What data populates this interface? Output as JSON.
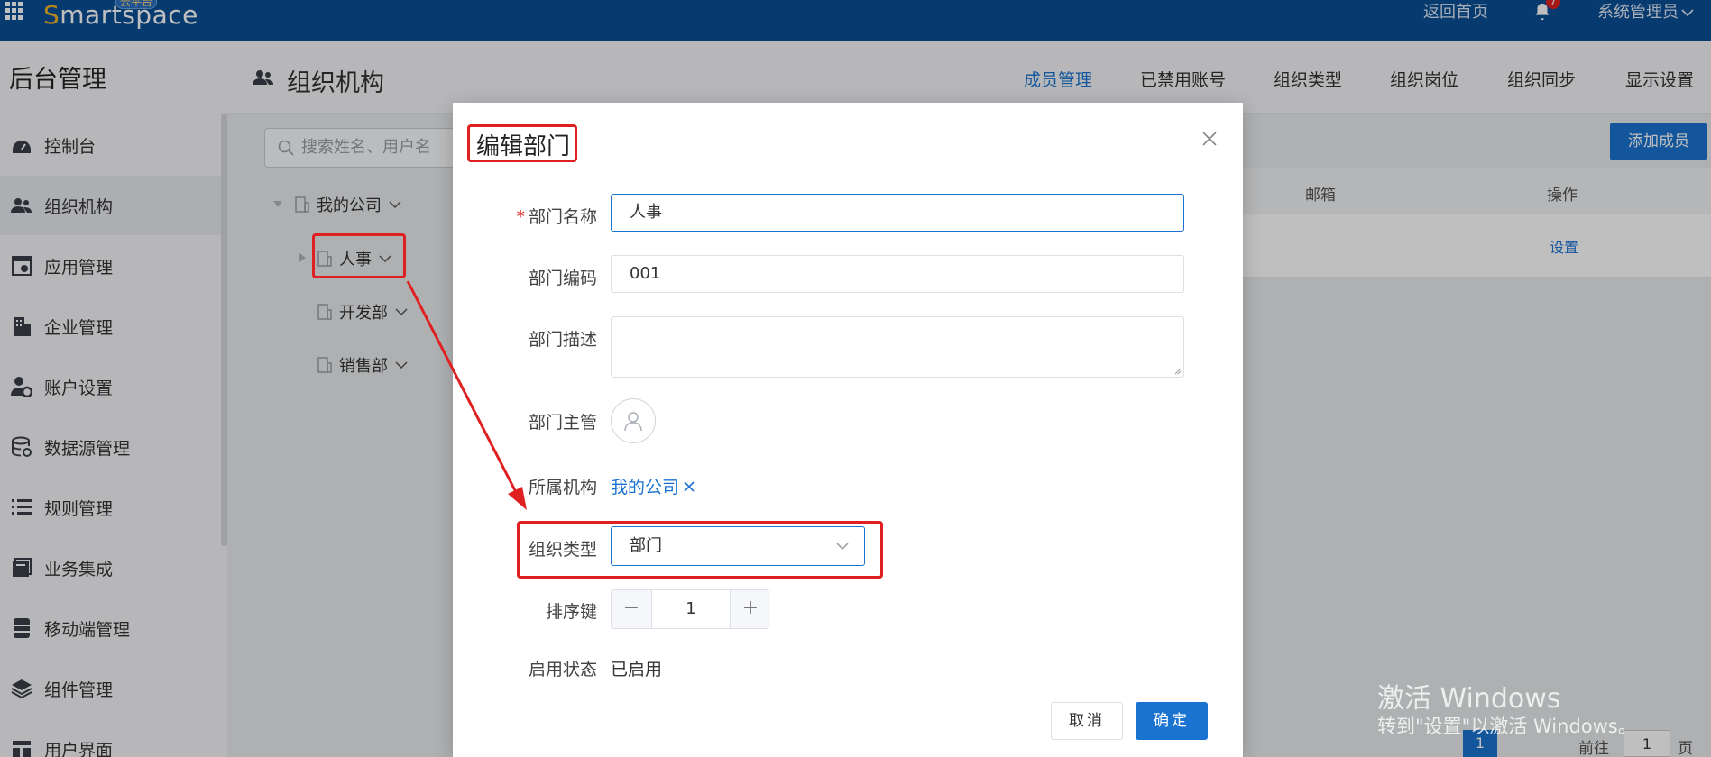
{
  "topbar": {
    "logo_s": "S",
    "logo_rest": "martspace",
    "logo_badge": "云平台",
    "home_link": "返回首页",
    "notification_count": "7",
    "user_menu": "系统管理员",
    "bg_color": "#0a4f96"
  },
  "sidebar": {
    "title": "后台管理",
    "items": [
      {
        "label": "控制台",
        "icon": "dashboard-icon"
      },
      {
        "label": "组织机构",
        "icon": "users-icon",
        "active": true
      },
      {
        "label": "应用管理",
        "icon": "app-settings-icon"
      },
      {
        "label": "企业管理",
        "icon": "building-icon"
      },
      {
        "label": "账户设置",
        "icon": "user-gear-icon"
      },
      {
        "label": "数据源管理",
        "icon": "database-icon"
      },
      {
        "label": "规则管理",
        "icon": "list-icon"
      },
      {
        "label": "业务集成",
        "icon": "book-icon"
      },
      {
        "label": "移动端管理",
        "icon": "server-icon"
      },
      {
        "label": "组件管理",
        "icon": "layers-icon"
      },
      {
        "label": "用户界面",
        "icon": "layout-icon"
      }
    ]
  },
  "header": {
    "page_title": "组织机构",
    "tabs": [
      {
        "label": "成员管理",
        "active": true
      },
      {
        "label": "已禁用账号"
      },
      {
        "label": "组织类型"
      },
      {
        "label": "组织岗位"
      },
      {
        "label": "组织同步"
      },
      {
        "label": "显示设置"
      }
    ]
  },
  "tree": {
    "search_placeholder": "搜索姓名、用户名",
    "root": "我的公司",
    "children": [
      "人事",
      "开发部",
      "销售部"
    ]
  },
  "table": {
    "add_button": "添加成员",
    "columns": [
      "邮箱",
      "操作"
    ],
    "row_action": "设置"
  },
  "modal": {
    "title": "编辑部门",
    "fields": {
      "name_label": "部门名称",
      "name_value": "人事",
      "code_label": "部门编码",
      "code_value": "001",
      "desc_label": "部门描述",
      "desc_value": "",
      "manager_label": "部门主管",
      "org_label": "所属机构",
      "org_value": "我的公司",
      "type_label": "组织类型",
      "type_value": "部门",
      "sort_label": "排序键",
      "sort_value": "1",
      "status_label": "启用状态",
      "status_value": "已启用"
    },
    "cancel": "取消",
    "ok": "确定"
  },
  "pagination": {
    "current_page": "1",
    "goto_label": "前往",
    "goto_value": "1",
    "page_suffix": "页"
  },
  "watermark": {
    "line1": "激活 Windows",
    "line2": "转到\"设置\"以激活 Windows。"
  },
  "colors": {
    "accent": "#1a73d1",
    "annotation_red": "#e02020"
  }
}
